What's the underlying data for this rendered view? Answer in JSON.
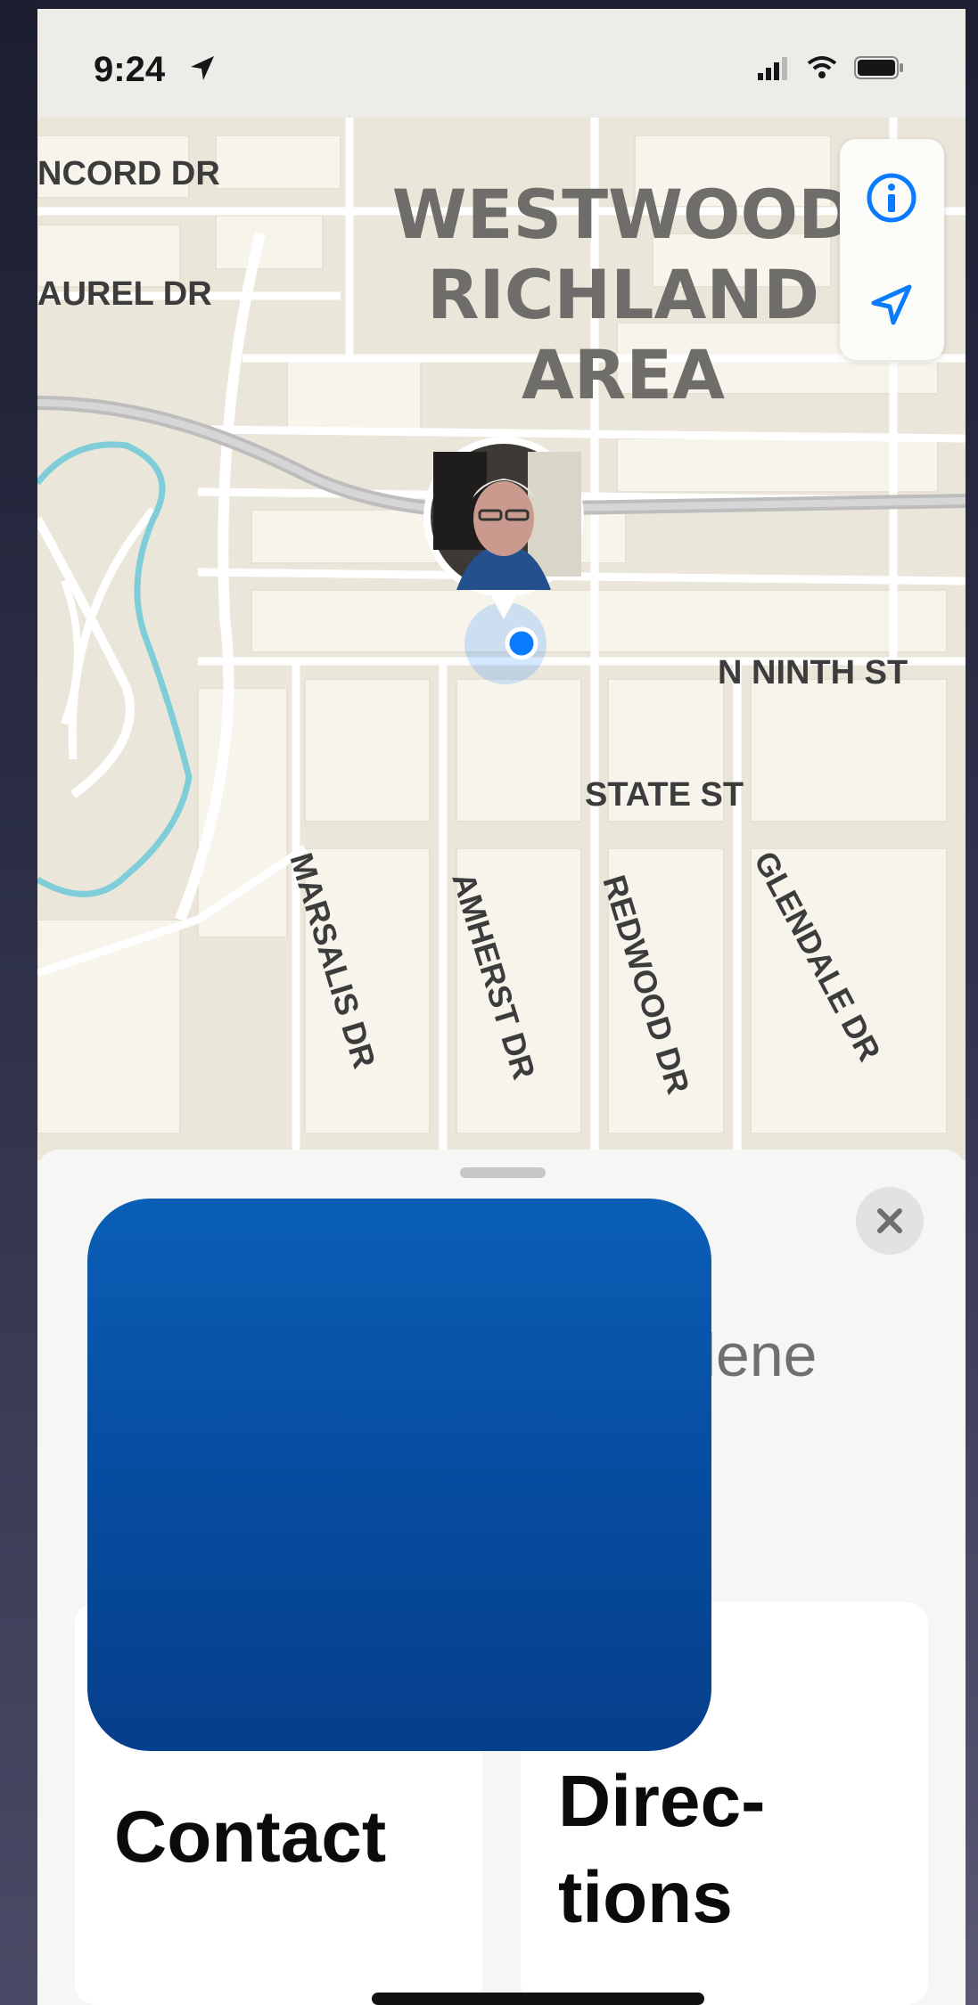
{
  "status_bar": {
    "time": "9:24",
    "location_arrow": "location-arrow-icon",
    "signal": "cellular-signal-icon",
    "wifi": "wifi-icon",
    "battery": "battery-icon"
  },
  "map": {
    "area_label": [
      "WESTWOOD",
      "RICHLAND",
      "AREA"
    ],
    "streets": {
      "concord": "NCORD DR",
      "laurel": "AUREL DR",
      "ninth": "N NINTH ST",
      "state": "STATE ST",
      "marsalis": "MARSALIS DR",
      "amherst": "AMHERST DR",
      "redwood": "REDWOOD DR",
      "glendale": "GLENDALE DR"
    },
    "controls": {
      "info_icon": "info-icon",
      "location_icon": "location-arrow-icon"
    },
    "colors": {
      "water": "#7ecdd8",
      "user_dot": "#0a7bff",
      "road": "#b8b8b8"
    }
  },
  "sheet": {
    "subtitle": "bilene",
    "close_icon": "close-icon",
    "actions": [
      {
        "label_lines": [
          "Contact"
        ],
        "color": "#34c759"
      },
      {
        "label_lines": [
          "Direc-",
          "tions"
        ],
        "color": "#0a7bff"
      }
    ],
    "redaction_color": "#0a5fb6"
  }
}
